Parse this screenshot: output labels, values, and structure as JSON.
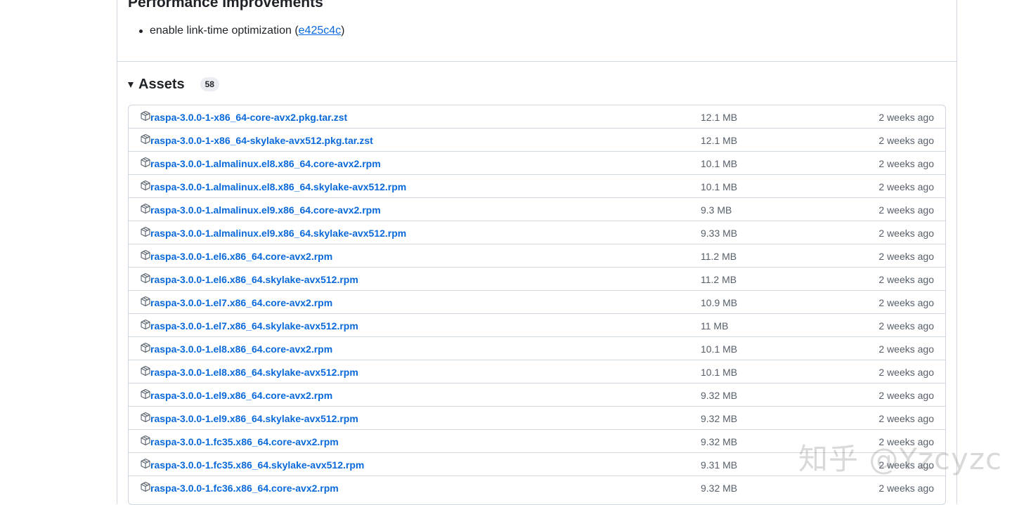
{
  "release": {
    "section_title": "Performance Improvements",
    "bullet_text": "enable link-time optimization (",
    "commit_link": "e425c4c",
    "bullet_close": ")"
  },
  "assets": {
    "title": "Assets",
    "count": "58",
    "items": [
      {
        "name": "raspa-3.0.0-1-x86_64-core-avx2.pkg.tar.zst",
        "size": "12.1 MB",
        "date": "2 weeks ago"
      },
      {
        "name": "raspa-3.0.0-1-x86_64-skylake-avx512.pkg.tar.zst",
        "size": "12.1 MB",
        "date": "2 weeks ago"
      },
      {
        "name": "raspa-3.0.0-1.almalinux.el8.x86_64.core-avx2.rpm",
        "size": "10.1 MB",
        "date": "2 weeks ago"
      },
      {
        "name": "raspa-3.0.0-1.almalinux.el8.x86_64.skylake-avx512.rpm",
        "size": "10.1 MB",
        "date": "2 weeks ago"
      },
      {
        "name": "raspa-3.0.0-1.almalinux.el9.x86_64.core-avx2.rpm",
        "size": "9.3 MB",
        "date": "2 weeks ago"
      },
      {
        "name": "raspa-3.0.0-1.almalinux.el9.x86_64.skylake-avx512.rpm",
        "size": "9.33 MB",
        "date": "2 weeks ago"
      },
      {
        "name": "raspa-3.0.0-1.el6.x86_64.core-avx2.rpm",
        "size": "11.2 MB",
        "date": "2 weeks ago"
      },
      {
        "name": "raspa-3.0.0-1.el6.x86_64.skylake-avx512.rpm",
        "size": "11.2 MB",
        "date": "2 weeks ago"
      },
      {
        "name": "raspa-3.0.0-1.el7.x86_64.core-avx2.rpm",
        "size": "10.9 MB",
        "date": "2 weeks ago"
      },
      {
        "name": "raspa-3.0.0-1.el7.x86_64.skylake-avx512.rpm",
        "size": "11 MB",
        "date": "2 weeks ago"
      },
      {
        "name": "raspa-3.0.0-1.el8.x86_64.core-avx2.rpm",
        "size": "10.1 MB",
        "date": "2 weeks ago"
      },
      {
        "name": "raspa-3.0.0-1.el8.x86_64.skylake-avx512.rpm",
        "size": "10.1 MB",
        "date": "2 weeks ago"
      },
      {
        "name": "raspa-3.0.0-1.el9.x86_64.core-avx2.rpm",
        "size": "9.32 MB",
        "date": "2 weeks ago"
      },
      {
        "name": "raspa-3.0.0-1.el9.x86_64.skylake-avx512.rpm",
        "size": "9.32 MB",
        "date": "2 weeks ago"
      },
      {
        "name": "raspa-3.0.0-1.fc35.x86_64.core-avx2.rpm",
        "size": "9.32 MB",
        "date": "2 weeks ago"
      },
      {
        "name": "raspa-3.0.0-1.fc35.x86_64.skylake-avx512.rpm",
        "size": "9.31 MB",
        "date": "2 weeks ago"
      },
      {
        "name": "raspa-3.0.0-1.fc36.x86_64.core-avx2.rpm",
        "size": "9.32 MB",
        "date": "2 weeks ago"
      }
    ]
  },
  "watermark": "知乎 @Yzcyzc",
  "icons": {
    "asset_icon": "package-icon",
    "caret_icon": "triangle-down-icon"
  },
  "colors": {
    "link": "#0969da",
    "border": "#d0d7de",
    "muted_text": "#57606a"
  }
}
